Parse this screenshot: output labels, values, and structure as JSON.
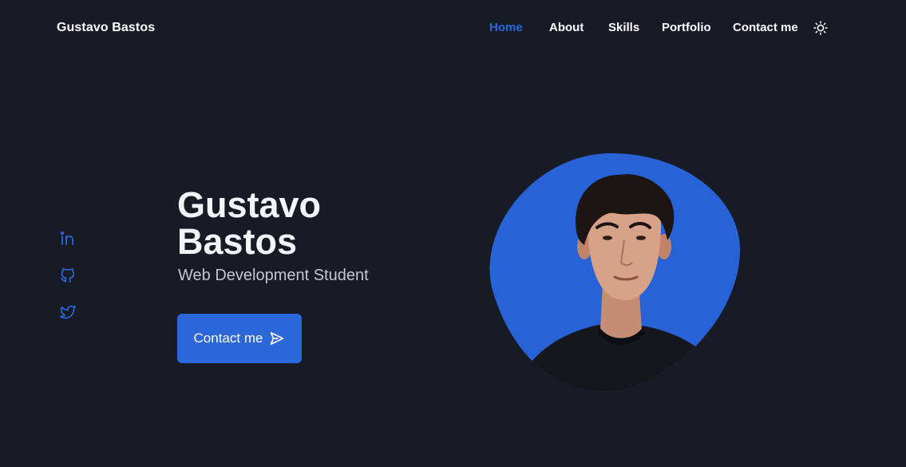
{
  "header": {
    "logo": "Gustavo Bastos",
    "nav": [
      {
        "label": "Home",
        "active": true
      },
      {
        "label": "About",
        "active": false
      },
      {
        "label": "Skills",
        "active": false
      },
      {
        "label": "Portfolio",
        "active": false
      },
      {
        "label": "Contact me",
        "active": false
      }
    ],
    "theme_toggle_icon": "sun-icon"
  },
  "social": [
    {
      "icon": "linkedin-icon"
    },
    {
      "icon": "github-icon"
    },
    {
      "icon": "twitter-icon"
    }
  ],
  "hero": {
    "title_line1": "Gustavo",
    "title_line2": "Bastos",
    "subtitle": "Web Development Student",
    "cta_label": "Contact me",
    "cta_icon": "send-icon"
  },
  "colors": {
    "background": "#171b26",
    "accent": "#2c67d9",
    "text": "#ffffff",
    "muted": "#c4c6cf"
  }
}
